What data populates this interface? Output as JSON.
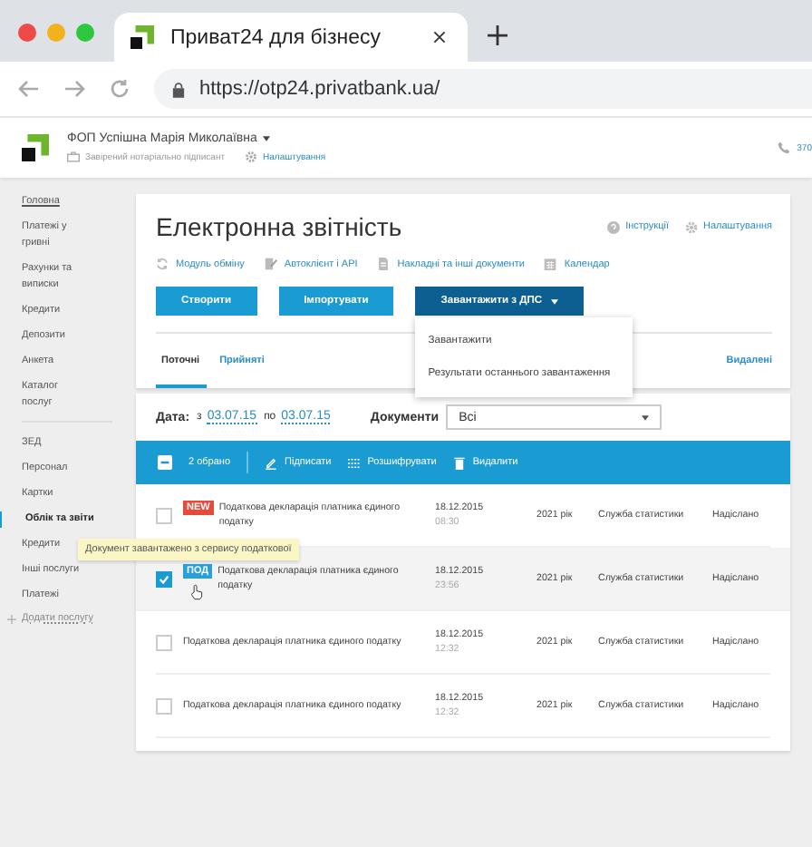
{
  "browser": {
    "tab_title": "Приват24 для бізнесу",
    "url": "https://otp24.privatbank.ua/"
  },
  "header": {
    "user": "ФОП Успішна Марія Миколаївна",
    "role": "Завірений нотаріально підписант",
    "settings": "Налаштування",
    "phone": "370"
  },
  "sidebar": {
    "groups": [
      [
        {
          "label": "Головна",
          "selected": false
        },
        {
          "label": "Платежі у гривні",
          "selected": false
        },
        {
          "label": "Рахунки та виписки",
          "selected": false
        },
        {
          "label": "Кредити",
          "selected": false
        },
        {
          "label": "Депозити",
          "selected": false
        },
        {
          "label": "Анкета",
          "selected": false
        },
        {
          "label": "Каталог послуг",
          "selected": false
        }
      ],
      [
        {
          "label": "ЗЕД",
          "selected": false
        },
        {
          "label": "Персонал",
          "selected": false
        },
        {
          "label": "Картки",
          "selected": false
        },
        {
          "label": "Облік та звіти",
          "selected": true
        },
        {
          "label": "Кредити",
          "selected": false
        },
        {
          "label": "Інші послуги",
          "selected": false
        },
        {
          "label": "Платежі",
          "selected": false
        }
      ]
    ],
    "add": "Додати послугу"
  },
  "page": {
    "title": "Електронна звітність",
    "help": "Інструкції",
    "settings": "Налаштування",
    "links": [
      {
        "kind": "exchange",
        "label": "Модуль обміну"
      },
      {
        "kind": "api",
        "label": "Автоклієнт і API"
      },
      {
        "kind": "docs",
        "label": "Накладні та інші документи"
      },
      {
        "kind": "calendar",
        "label": "Календар"
      }
    ],
    "buttons": [
      {
        "label": "Створити"
      },
      {
        "label": "Імпортувати"
      }
    ],
    "dps": {
      "label": "Завантажити з ДПС",
      "open": true,
      "items": [
        "Завантажити",
        "Результати останнього завантаження"
      ]
    },
    "tabs": [
      {
        "label": "Поточні",
        "selected": true
      },
      {
        "label": "Прийняті",
        "selected": false
      }
    ],
    "deleted": "Видалені"
  },
  "filter": {
    "date_label": "Дата:",
    "from": "з",
    "from_date": "03.07.15",
    "to": "по",
    "to_date": "03.07.15",
    "docs_label": "Документи",
    "docs_value": "Всі"
  },
  "actions": {
    "partly_selected": true,
    "count": "2 обрано",
    "sign": "Підписати",
    "decrypt": "Розшифрувати",
    "delete": "Видалити"
  },
  "rows": [
    {
      "checked": false,
      "badge": {
        "kind": "new",
        "text": "NEW"
      },
      "title": "Податкова декларація платника єдиного податку",
      "date": "18.12.2015",
      "time": "08:30",
      "year": "2021 рік",
      "org": "Служба статистики",
      "status": "Надіслано"
    },
    {
      "checked": true,
      "badge": {
        "kind": "tax",
        "text": "ПОД"
      },
      "title": "Податкова декларація платника єдиного податку",
      "date": "18.12.2015",
      "time": "23:56",
      "year": "2021 рік",
      "org": "Служба статистики",
      "status": "Надіслано"
    },
    {
      "checked": false,
      "title": "Податкова декларація платника єдиного податку",
      "date": "18.12.2015",
      "time": "12:32",
      "year": "2021 рік",
      "org": "Служба статистики",
      "status": "Надіслано"
    },
    {
      "checked": false,
      "title": "Податкова декларація платника єдиного податку",
      "date": "18.12.2015",
      "time": "12:32",
      "year": "2021 рік",
      "org": "Служба статистики",
      "status": "Надіслано"
    }
  ],
  "tooltip": "Документ  завантажено з сервису податкової"
}
